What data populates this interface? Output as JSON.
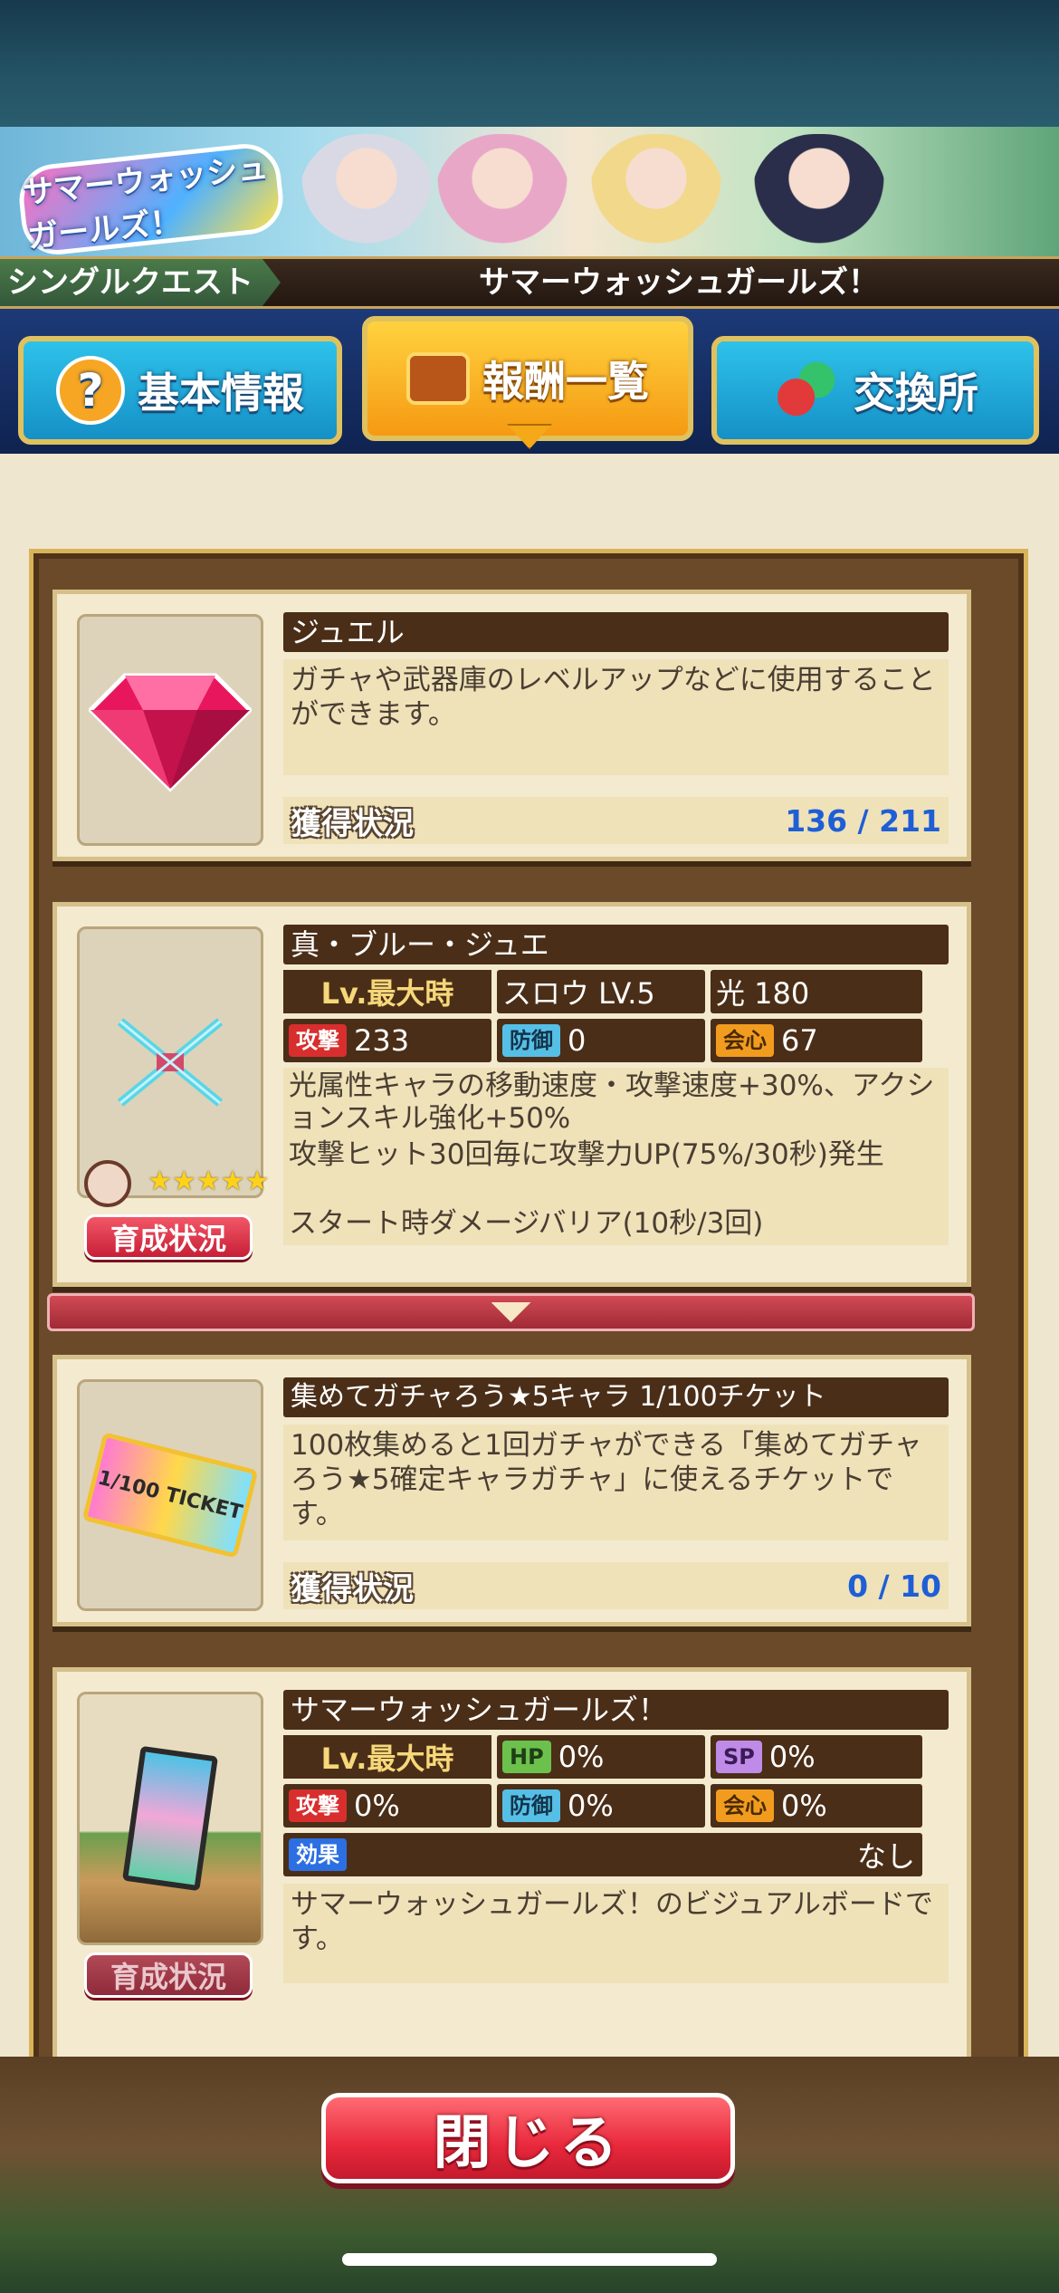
{
  "header": {
    "logo_text": "サマーウォッシュガールズ！",
    "quest_type": "シングルクエスト",
    "quest_name": "サマーウォッシュガールズ！"
  },
  "tabs": [
    {
      "label": "基本情報",
      "icon": "question-icon",
      "active": false
    },
    {
      "label": "報酬一覧",
      "icon": "treasure-chest-icon",
      "active": true
    },
    {
      "label": "交換所",
      "icon": "exchange-icon",
      "active": false
    }
  ],
  "rewards": {
    "jewel": {
      "name": "ジュエル",
      "description": "ガチャや武器庫のレベルアップなどに使用することができます。",
      "status_label": "獲得状況",
      "status_value": "136 / 211",
      "icon": "jewel-icon"
    },
    "weapon": {
      "name": "真・ブルー・ジュエ",
      "lv_label": "Lv.最大時",
      "skill_type": "スロウ LV.5",
      "element": "光 180",
      "atk_label": "攻撃",
      "atk_value": "233",
      "def_label": "防御",
      "def_value": "0",
      "crit_label": "会心",
      "crit_value": "67",
      "skill1": "光属性キャラの移動速度・攻撃速度+30%、アクションスキル強化+50%",
      "skill2": "攻撃ヒット30回毎に攻撃力UP(75%/30秒)発生",
      "skill3": "スタート時ダメージバリア(10秒/3回)",
      "stars": "★★★★★",
      "grow_label": "育成状況",
      "icon": "crossed-blades-icon"
    },
    "ticket": {
      "name": "集めてガチャろう★5キャラ 1/100チケット",
      "description": "100枚集めると1回ガチャができる「集めてガチャろう★5確定キャラガチャ」に使えるチケットです。",
      "status_label": "獲得状況",
      "status_value": "0 / 10",
      "ticket_text": "1/100 TICKET",
      "icon": "ticket-icon"
    },
    "board": {
      "name": "サマーウォッシュガールズ！",
      "lv_label": "Lv.最大時",
      "hp_label": "HP",
      "hp_value": "0%",
      "sp_label": "SP",
      "sp_value": "0%",
      "atk_label": "攻撃",
      "atk_value": "0%",
      "def_label": "防御",
      "def_value": "0%",
      "crit_label": "会心",
      "crit_value": "0%",
      "effect_label": "効果",
      "effect_value": "なし",
      "description": "サマーウォッシュガールズ！のビジュアルボードです。",
      "grow_label": "育成状況",
      "icon": "visual-board-icon"
    }
  },
  "footer": {
    "close_label": "閉じる"
  },
  "colors": {
    "accent_gold": "#d8b35a",
    "active_tab": "#f59a12",
    "tab_blue": "#1590c6",
    "close_red": "#e8283c",
    "value_blue": "#1e5ed6"
  }
}
